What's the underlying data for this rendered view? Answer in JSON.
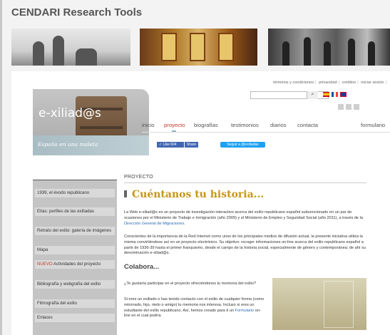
{
  "site_title": "CENDARI Research Tools",
  "toplinks": [
    "términos y condiciones",
    "privacidad",
    "créditos",
    "iniciar sesión"
  ],
  "search": {
    "placeholder": "",
    "button_icon": "search-icon"
  },
  "logo": {
    "text": "e-xiliad@s",
    "tagline": "España en una maleta"
  },
  "nav": [
    "inicio",
    "proyecto",
    "biografías",
    "testimonios",
    "diarios",
    "contacta",
    "formulario"
  ],
  "social": {
    "like": "✓ Like 604",
    "share": "Share",
    "twitter": "Seguir a @exiliadas"
  },
  "sidebar": [
    {
      "label": "1939, el éxodo republicano",
      "new": ""
    },
    {
      "label": "Elías: perfiles de las exiliadas",
      "new": ""
    },
    {
      "label": "Retrato del exilio: galería de imágenes",
      "new": ""
    },
    {
      "label": "Mapa",
      "new": ""
    },
    {
      "label": "Actividades del proyecto",
      "new": "NUEVO"
    },
    {
      "label": "Bibliografía y webgrafía del exilio",
      "new": ""
    },
    {
      "label": "Filmografía del exilio",
      "new": ""
    },
    {
      "label": "Enlaces",
      "new": ""
    }
  ],
  "content": {
    "section": "PROYECTO",
    "title": "Cuéntanos tu historia...",
    "p1_a": "La Web e-xiliad@s es un proyecto de investigación interactivo acerca del exilio republicano español subvencionado en un par de ocasiones por el Ministerio de Trabajo e Inmigración (año 2009) y el Ministerio de Empleo y Seguridad Social (año 2011), a través de la",
    "p1_link": "Dirección General de Migraciones",
    "p1_b": ".",
    "p2": "Conscientes de la importancia de la Red Internet como unos de los principales medios de difusión actual, la presente iniciativa utiliza la misma convirtiéndose así en un proyecto electrónico. Su objetivo: recoger informaciones on-line acerca del exilio republicano español a partir de 1936-39 hasta el primer franquismo, desde el campo de la historia social, especialmente de género y contemporánea: de ahí su denominación e-xiliad@s.",
    "subtitle": "Colabora...",
    "p3": "¿Te gustaría participar en el proyecto ofreciéndonos tu memoria del exilio?",
    "p4_a": "Si eres un exiliado o has tenido contacto con el exilio de cualquier forma (como retornado, hijo, nieto o amigo) tu memoria nos interesa. Incluso si eres un estudiante del exilio republicano. Así, hemos creado para ti un",
    "p4_link": "Formulario",
    "p4_b": "on-line en el cual podría"
  }
}
